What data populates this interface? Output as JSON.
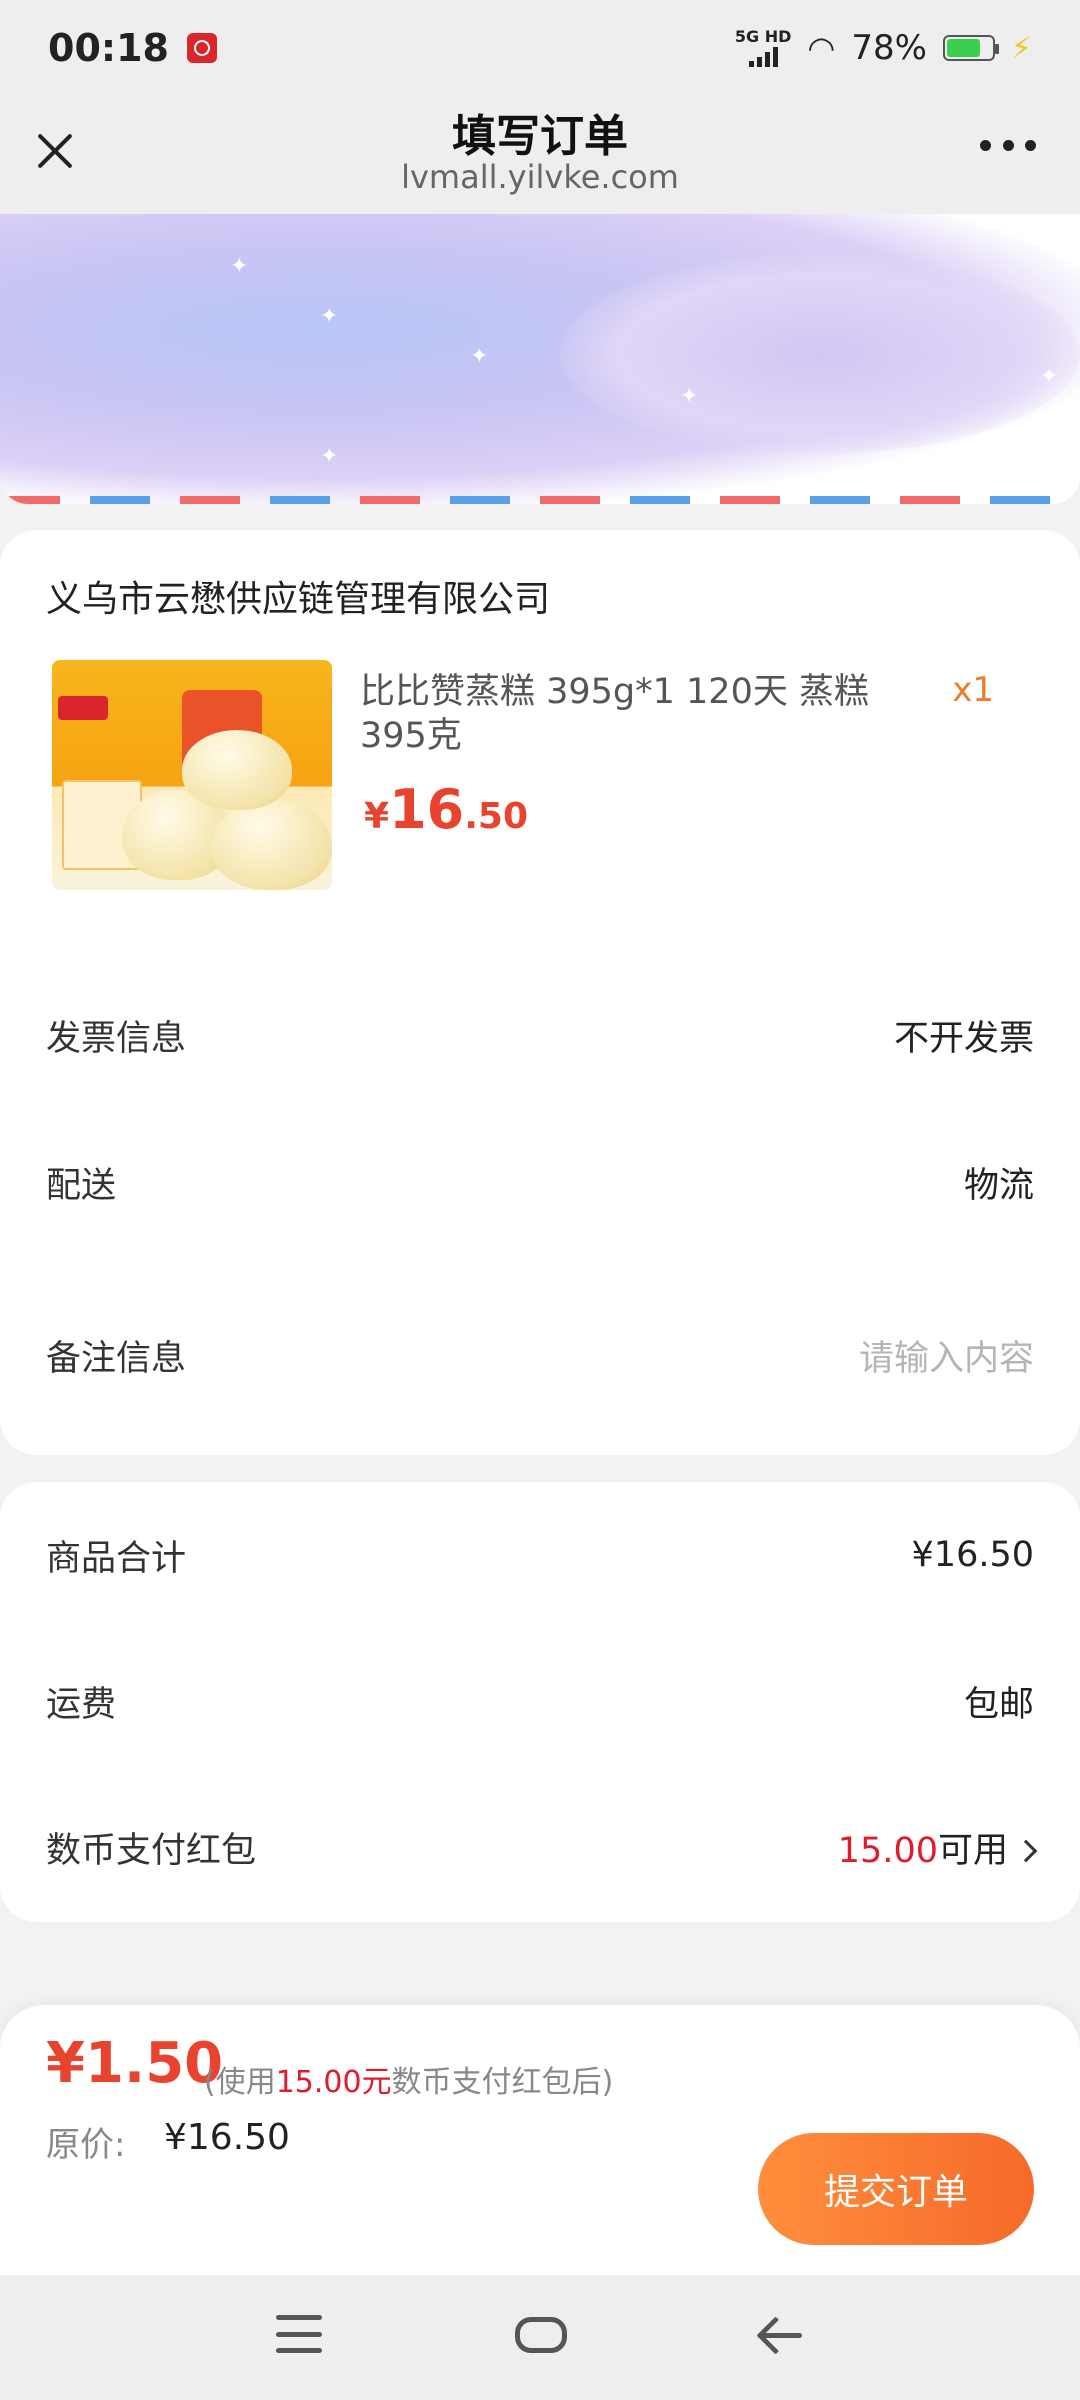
{
  "status_bar": {
    "time": "00:18",
    "network": "5G HD",
    "battery": "78%",
    "battery_level": 0.78,
    "icons": [
      "app-badge-icon",
      "signal-icon",
      "wifi-icon",
      "battery-icon",
      "charging-icon"
    ]
  },
  "header": {
    "title": "填写订单",
    "url": "lvmall.yilvke.com"
  },
  "order": {
    "shop_name": "义乌市云懋供应链管理有限公司",
    "product": {
      "title": "比比赞蒸糕 395g*1 120天 蒸糕395克",
      "quantity": "x1",
      "price_symbol": "¥",
      "price_int": "16",
      "price_dec": ".50"
    },
    "invoice": {
      "label": "发票信息",
      "value": "不开发票"
    },
    "delivery": {
      "label": "配送",
      "value": "物流"
    },
    "remark": {
      "label": "备注信息",
      "placeholder": "请输入内容"
    }
  },
  "summary": {
    "subtotal": {
      "label": "商品合计",
      "value": "¥16.50"
    },
    "shipping": {
      "label": "运费",
      "value": "包邮"
    },
    "coin_redpacket": {
      "label": "数币支付红包",
      "amount": "15.00",
      "suffix": "可用"
    }
  },
  "checkout": {
    "final_price": "¥1.50",
    "note_prefix": "(使用",
    "note_amount": "15.00元",
    "note_suffix": "数币支付红包后)",
    "original_label": "原价:",
    "original_value": "¥16.50",
    "submit_label": "提交订单"
  },
  "colors": {
    "accent_red": "#e8432e",
    "button_orange": "#f66a2a",
    "quantity_orange": "#f07b2a"
  }
}
